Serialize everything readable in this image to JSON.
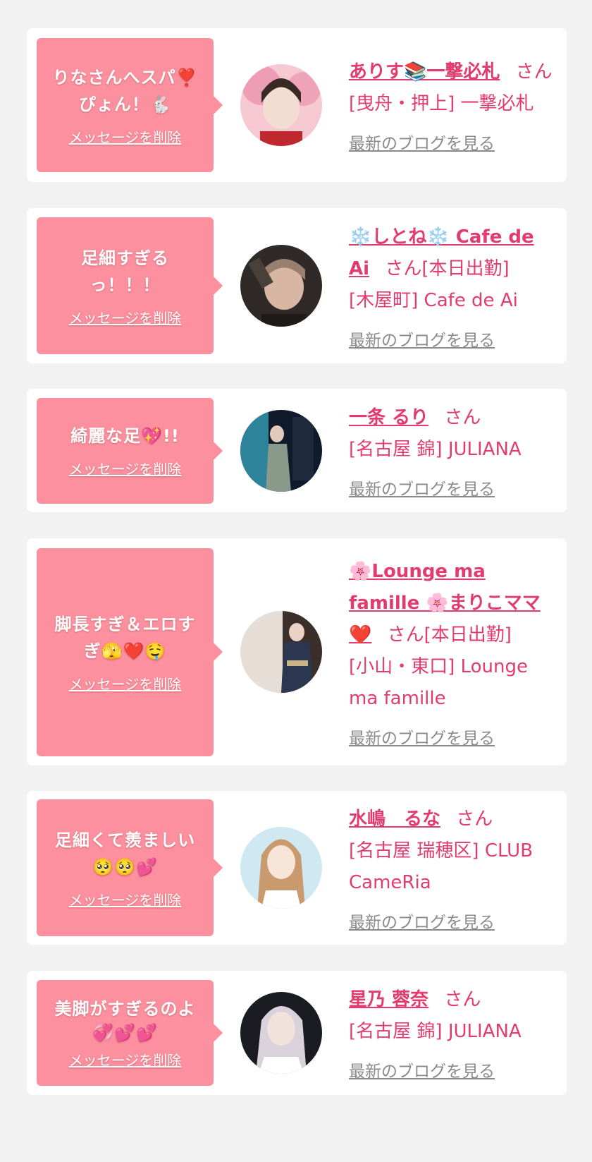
{
  "cards": [
    {
      "message": "りなさんへスパ❣️ぴょん！🐇",
      "delete_label": "メッセージを削除",
      "name": "ありす📚一撃必札",
      "san": "さん",
      "status": "",
      "shop": "[曳舟・押上] 一撃必札",
      "blog_label": "最新のブログを見る",
      "avatar_colors": [
        "#e98aa8",
        "#f6c9d2"
      ]
    },
    {
      "message": "足細すぎるっ！！！",
      "delete_label": "メッセージを削除",
      "name": "❄️しとね❄️ Cafe de Ai",
      "san": "さん",
      "status": "[本日出勤]",
      "shop": "[木屋町] Cafe de Ai",
      "blog_label": "最新のブログを見る",
      "avatar_colors": [
        "#2f2a28",
        "#9a7f6e"
      ]
    },
    {
      "message": "綺麗な足💖!!",
      "delete_label": "メッセージを削除",
      "name": "一条 るり",
      "san": "さん",
      "status": "",
      "shop": "[名古屋 錦] JULIANA",
      "blog_label": "最新のブログを見る",
      "avatar_colors": [
        "#0f1a2a",
        "#3ab0c9"
      ]
    },
    {
      "message": "脚長すぎ＆エロすぎ🫣❤️🤤",
      "delete_label": "メッセージを削除",
      "name": "🌸Lounge ma famille 🌸まりこママ❤️",
      "san": "さん",
      "status": "[本日出勤]",
      "shop": "[小山・東口] Lounge ma famille",
      "blog_label": "最新のブログを見る",
      "avatar_colors": [
        "#e6ded6",
        "#2b3650"
      ]
    },
    {
      "message": "足細くて羨ましい🥺🥺💕",
      "delete_label": "メッセージを削除",
      "name": "水嶋　るな",
      "san": "さん",
      "status": "",
      "shop": "[名古屋 瑞穂区] CLUB CameRia",
      "blog_label": "最新のブログを見る",
      "avatar_colors": [
        "#cfe8f2",
        "#f7e6d8"
      ]
    },
    {
      "message": "美脚がすぎるのよ💞💕💕",
      "delete_label": "メッセージを削除",
      "name": "星乃 蓉奈",
      "san": "さん",
      "status": "",
      "shop": "[名古屋 錦] JULIANA",
      "blog_label": "最新のブログを見る",
      "avatar_colors": [
        "#1b1b22",
        "#d9d2da"
      ]
    }
  ]
}
